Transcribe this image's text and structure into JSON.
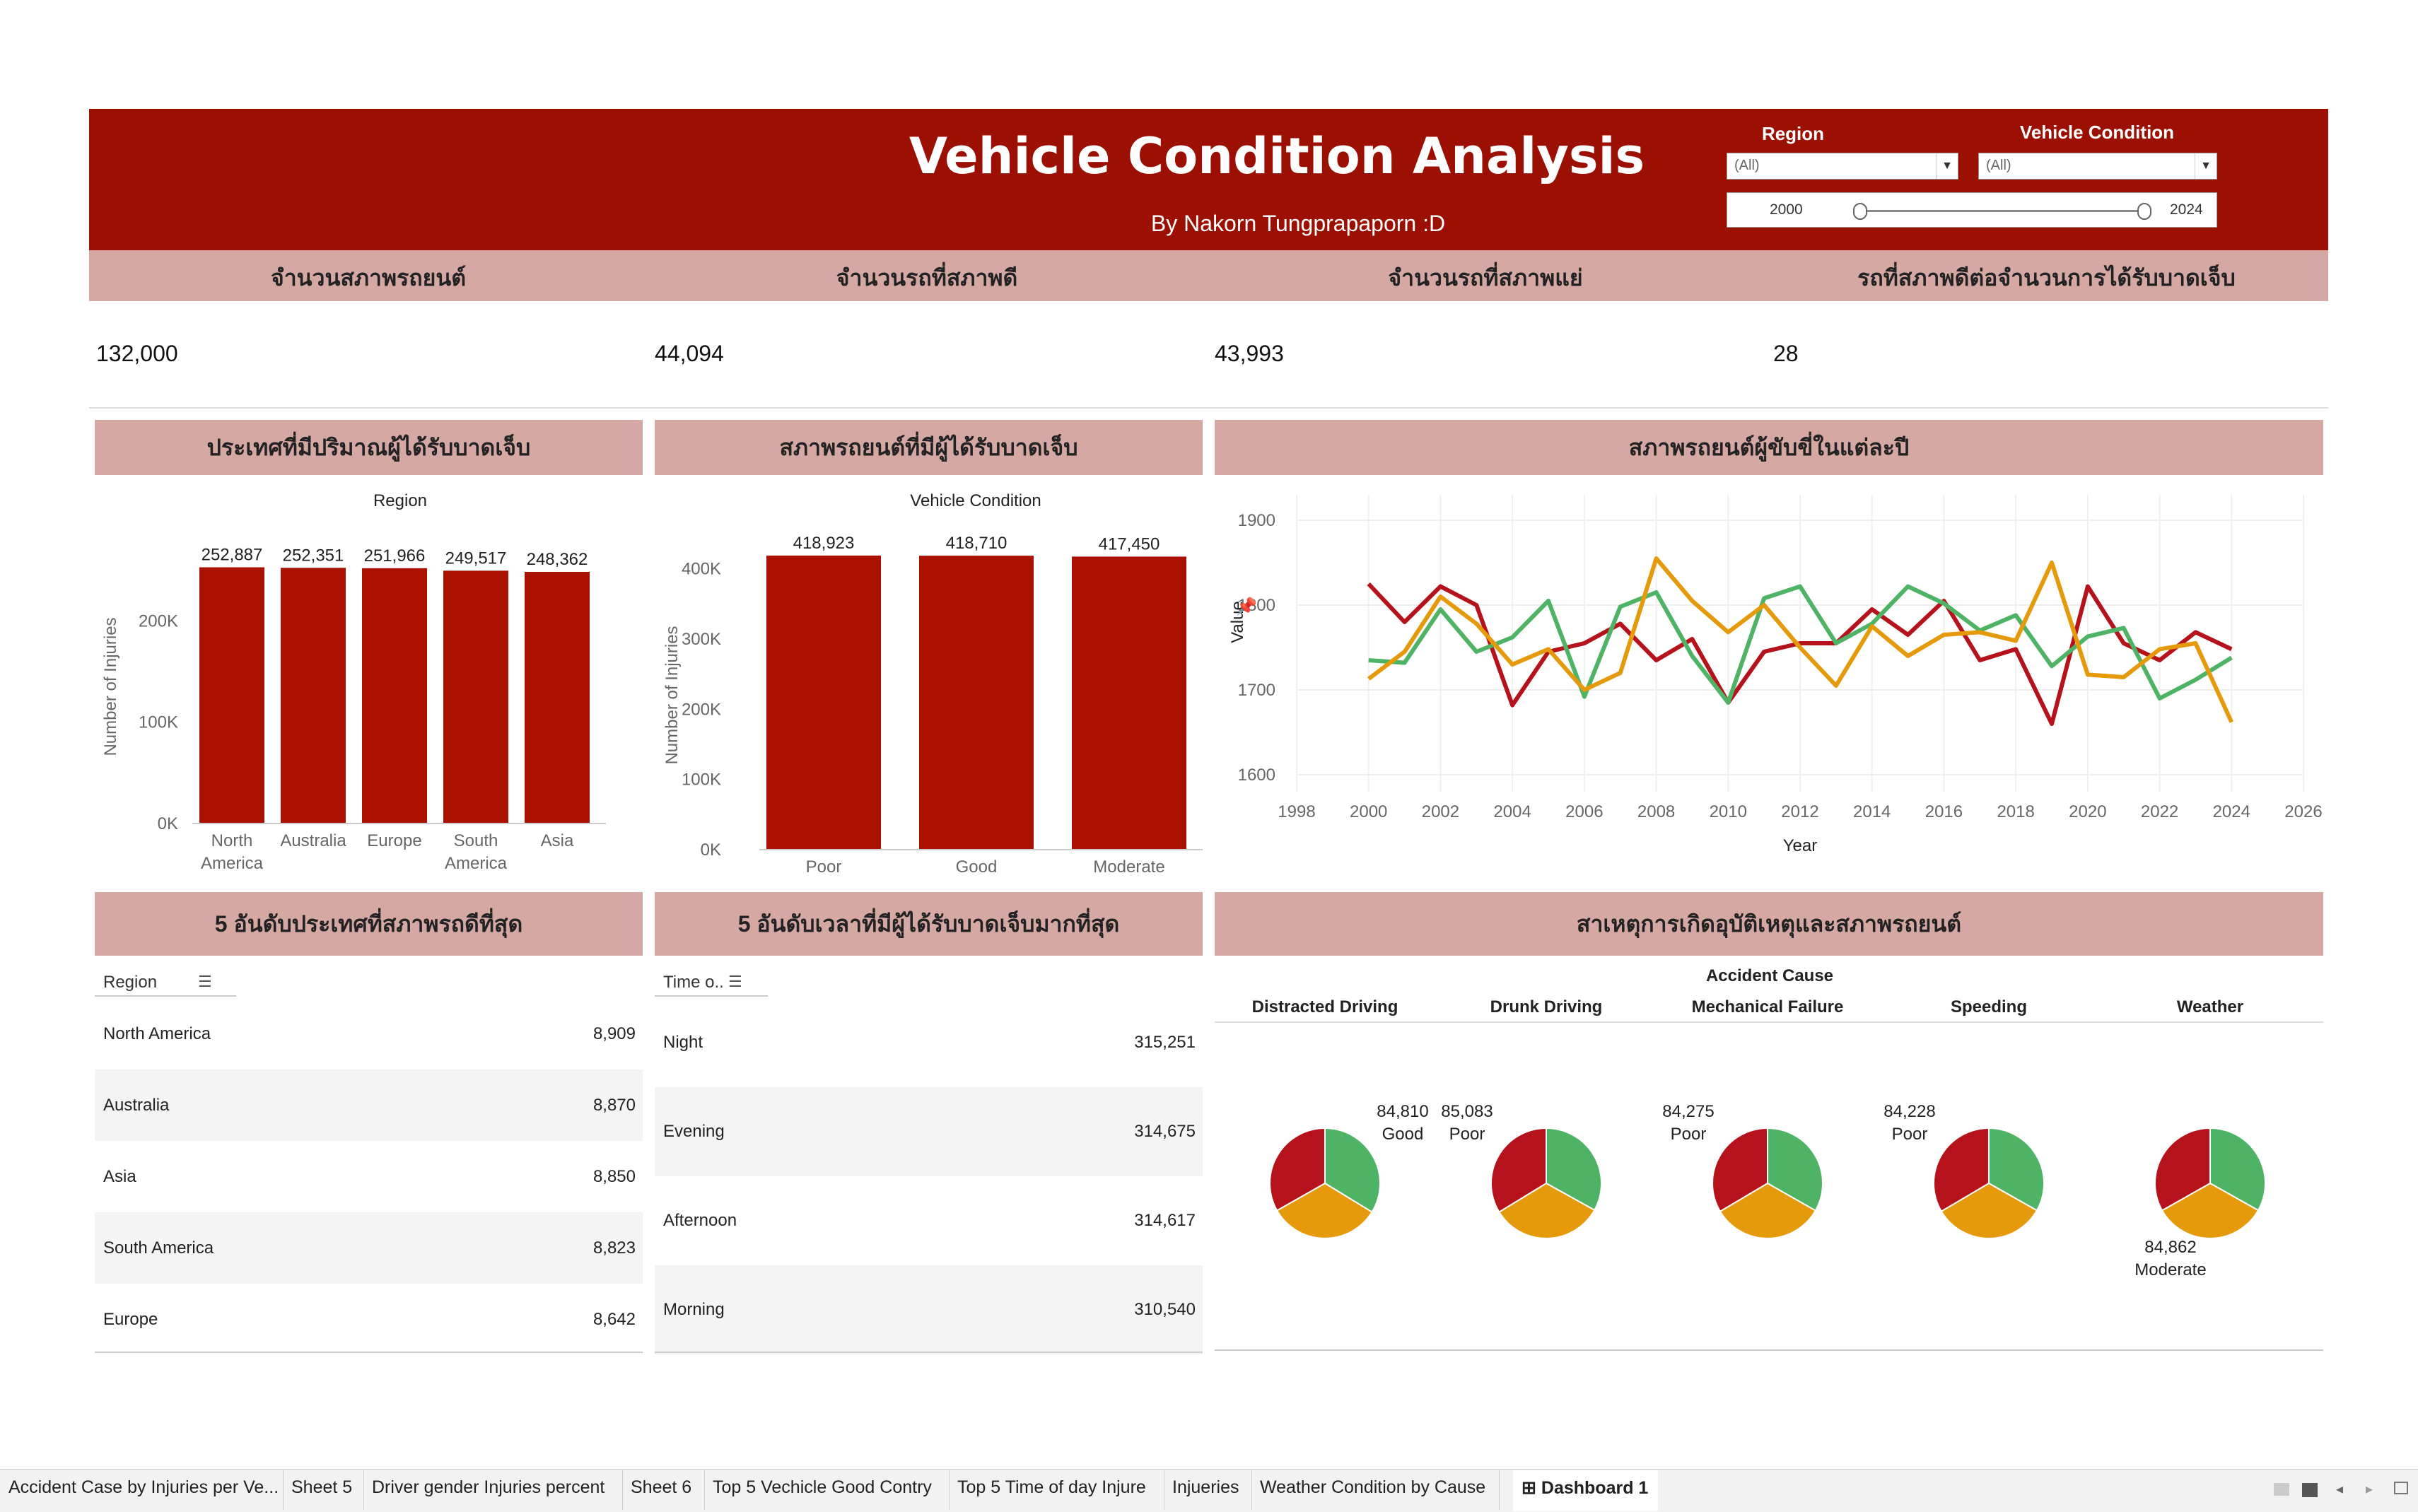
{
  "header": {
    "title": "Vehicle Condition Analysis",
    "subtitle": "By Nakorn Tungprapaporn :D",
    "filters": {
      "region_label": "Region",
      "region_value": "(All)",
      "condition_label": "Vehicle Condition",
      "condition_value": "(All)",
      "year_start": "2000",
      "year_end": "2024"
    }
  },
  "kpis": [
    {
      "label": "จำนวนสภาพรถยนต์",
      "value": "132,000"
    },
    {
      "label": "จำนวนรถที่สภาพดี",
      "value": "44,094"
    },
    {
      "label": "จำนวนรถที่สภาพแย่",
      "value": "43,993"
    },
    {
      "label": "รถที่สภาพดีต่อจำนวนการได้รับบาดเจ็บ",
      "value": "28"
    }
  ],
  "panels": {
    "region_bars_title": "ประเทศที่มีปริมาณผู้ได้รับบาดเจ็บ",
    "condition_bars_title": "สภาพรถยนต์ที่มีผู้ได้รับบาดเจ็บ",
    "line_title": "สภาพรถยนต์ผู้ขับขี่ในแต่ละปี",
    "top_region_title": "5 อันดับประเทศที่สภาพรถดีที่สุด",
    "top_time_title": "5 อันดับเวลาที่มีผู้ได้รับบาดเจ็บมากที่สุด",
    "cause_title": "สาเหตุการเกิดอุบัติเหตุและสภาพรถยนต์"
  },
  "colors": {
    "brand": "#9b1003",
    "bar": "#aa1100",
    "header_band": "#d6a8a4",
    "poor": "#b5121b",
    "good": "#4fb366",
    "moderate": "#e59a0b"
  },
  "chart_data": [
    {
      "type": "bar",
      "title": "Region",
      "categories": [
        "North America",
        "Australia",
        "Europe",
        "South America",
        "Asia"
      ],
      "values": [
        252887,
        252351,
        251966,
        249517,
        248362
      ],
      "value_labels": [
        "252,887",
        "252,351",
        "251,966",
        "249,517",
        "248,362"
      ],
      "ylabel": "Number of Injuries",
      "yticks": [
        "0K",
        "100K",
        "200K"
      ],
      "ylim": [
        0,
        270000
      ]
    },
    {
      "type": "bar",
      "title": "Vehicle Condition",
      "categories": [
        "Poor",
        "Good",
        "Moderate"
      ],
      "values": [
        418923,
        418710,
        417450
      ],
      "value_labels": [
        "418,923",
        "418,710",
        "417,450"
      ],
      "ylabel": "Number of Injuries",
      "yticks": [
        "0K",
        "100K",
        "200K",
        "300K",
        "400K"
      ],
      "ylim": [
        0,
        440000
      ]
    },
    {
      "type": "line",
      "xlabel": "Year",
      "ylabel": "Value",
      "xlim": [
        1998,
        2026
      ],
      "ylim": [
        1580,
        1930
      ],
      "xticks": [
        "1998",
        "2000",
        "2002",
        "2004",
        "2006",
        "2008",
        "2010",
        "2012",
        "2014",
        "2016",
        "2018",
        "2020",
        "2022",
        "2024",
        "2026"
      ],
      "yticks": [
        "1600",
        "1700",
        "1800",
        "1900"
      ],
      "x": [
        2000,
        2001,
        2002,
        2003,
        2004,
        2005,
        2006,
        2007,
        2008,
        2009,
        2010,
        2011,
        2012,
        2013,
        2014,
        2015,
        2016,
        2017,
        2018,
        2019,
        2020,
        2021,
        2022,
        2023,
        2024
      ],
      "series": [
        {
          "color": "#b5121b",
          "values": [
            1825,
            1780,
            1822,
            1800,
            1682,
            1745,
            1755,
            1778,
            1735,
            1760,
            1685,
            1745,
            1755,
            1755,
            1795,
            1765,
            1805,
            1735,
            1748,
            1660,
            1822,
            1755,
            1735,
            1768,
            1748
          ]
        },
        {
          "color": "#4fb366",
          "values": [
            1735,
            1732,
            1795,
            1745,
            1762,
            1805,
            1692,
            1798,
            1815,
            1740,
            1685,
            1808,
            1822,
            1755,
            1778,
            1822,
            1802,
            1770,
            1788,
            1728,
            1763,
            1773,
            1690,
            1712,
            1738
          ]
        },
        {
          "color": "#e59a0b",
          "values": [
            1713,
            1745,
            1810,
            1778,
            1730,
            1748,
            1700,
            1720,
            1855,
            1805,
            1768,
            1800,
            1750,
            1705,
            1775,
            1740,
            1765,
            1768,
            1758,
            1850,
            1718,
            1715,
            1748,
            1755,
            1662
          ]
        }
      ]
    },
    {
      "type": "table",
      "header": "Region",
      "rows": [
        {
          "name": "North America",
          "value": "8,909"
        },
        {
          "name": "Australia",
          "value": "8,870"
        },
        {
          "name": "Asia",
          "value": "8,850"
        },
        {
          "name": "South America",
          "value": "8,823"
        },
        {
          "name": "Europe",
          "value": "8,642"
        }
      ]
    },
    {
      "type": "table",
      "header": "Time o..",
      "rows": [
        {
          "name": "Night",
          "value": "315,251"
        },
        {
          "name": "Evening",
          "value": "314,675"
        },
        {
          "name": "Afternoon",
          "value": "314,617"
        },
        {
          "name": "Morning",
          "value": "310,540"
        }
      ]
    },
    {
      "type": "pie",
      "title": "Accident Cause",
      "categories": [
        "Distracted Driving",
        "Drunk Driving",
        "Mechanical Failure",
        "Speeding",
        "Weather"
      ],
      "slice_order": [
        "Good",
        "Moderate",
        "Poor"
      ],
      "pies": [
        {
          "cause": "Distracted Driving",
          "values": [
            84810,
            83000,
            83500
          ],
          "label_value": "84,810",
          "label_cat": "Good",
          "label_pos": "top-right"
        },
        {
          "cause": "Drunk Driving",
          "values": [
            83500,
            83800,
            85083
          ],
          "label_value": "85,083",
          "label_cat": "Poor",
          "label_pos": "top-left"
        },
        {
          "cause": "Mechanical Failure",
          "values": [
            83600,
            83700,
            84275
          ],
          "label_value": "84,275",
          "label_cat": "Poor",
          "label_pos": "top-left"
        },
        {
          "cause": "Speeding",
          "values": [
            83500,
            83900,
            84228
          ],
          "label_value": "84,228",
          "label_cat": "Poor",
          "label_pos": "top-left"
        },
        {
          "cause": "Weather",
          "values": [
            83600,
            84862,
            83700
          ],
          "label_value": "84,862",
          "label_cat": "Moderate",
          "label_pos": "bottom-left"
        }
      ]
    }
  ],
  "tabs": [
    "Accident Case by Injuries per Ve...",
    "Sheet 5",
    "Driver gender Injuries percent",
    "Sheet 6",
    "Top 5 Vechicle Good Contry",
    "Top 5 Time of day Injure",
    "Injueries",
    "Weather Condition by Cause",
    "Dashboard 1"
  ]
}
